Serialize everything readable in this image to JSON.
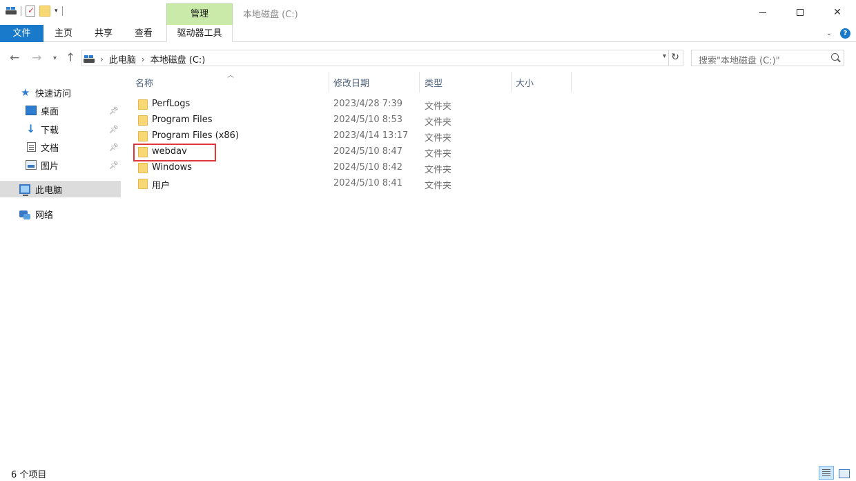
{
  "window": {
    "title": "本地磁盘 (C:)",
    "context_tab": "管理"
  },
  "ribbon": {
    "tabs": [
      {
        "label": "文件"
      },
      {
        "label": "主页"
      },
      {
        "label": "共享"
      },
      {
        "label": "查看"
      },
      {
        "label": "驱动器工具"
      }
    ]
  },
  "address": {
    "crumbs": [
      "此电脑",
      "本地磁盘 (C:)"
    ]
  },
  "search": {
    "placeholder": "搜索\"本地磁盘 (C:)\""
  },
  "sidebar": {
    "items": [
      {
        "label": "快速访问",
        "icon": "star-icon"
      },
      {
        "label": "桌面",
        "icon": "desktop-icon",
        "pinned": true
      },
      {
        "label": "下载",
        "icon": "download-icon",
        "pinned": true
      },
      {
        "label": "文档",
        "icon": "document-icon",
        "pinned": true
      },
      {
        "label": "图片",
        "icon": "pictures-icon",
        "pinned": true
      },
      {
        "label": "此电脑",
        "icon": "this-pc-icon",
        "selected": true
      },
      {
        "label": "网络",
        "icon": "network-icon"
      }
    ]
  },
  "columns": {
    "name": "名称",
    "date": "修改日期",
    "type": "类型",
    "size": "大小"
  },
  "files": [
    {
      "name": "PerfLogs",
      "date": "2023/4/28 7:39",
      "type": "文件夹"
    },
    {
      "name": "Program Files",
      "date": "2024/5/10 8:53",
      "type": "文件夹"
    },
    {
      "name": "Program Files (x86)",
      "date": "2023/4/14 13:17",
      "type": "文件夹"
    },
    {
      "name": "webdav",
      "date": "2024/5/10 8:47",
      "type": "文件夹",
      "highlighted": true
    },
    {
      "name": "Windows",
      "date": "2024/5/10 8:42",
      "type": "文件夹"
    },
    {
      "name": "用户",
      "date": "2024/5/10 8:41",
      "type": "文件夹"
    }
  ],
  "status": {
    "count": "6 个项目"
  },
  "colors": {
    "file_tab": "#1979ca",
    "manage_tab": "#c9eaa9",
    "highlight_border": "#e0363a",
    "folder": "#f8d775"
  }
}
